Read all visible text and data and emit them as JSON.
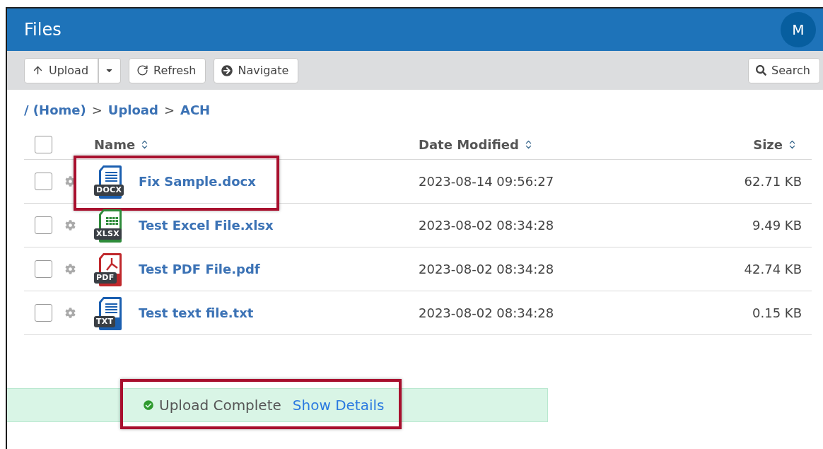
{
  "window": {
    "title": "Files",
    "avatar": "M"
  },
  "toolbar": {
    "buttons": [
      {
        "kind": "upload",
        "label": "Upload"
      },
      {
        "kind": "refresh",
        "label": "Refresh"
      },
      {
        "kind": "navigate",
        "label": "Navigate"
      }
    ],
    "search": "Search"
  },
  "breadcrumb": [
    "/ (Home)",
    "Upload",
    "ACH"
  ],
  "breadcrumb_separator": ">",
  "table": {
    "select_all_checked": false,
    "columns": [
      "Name",
      "Date Modified",
      "Size"
    ],
    "rows": [
      {
        "kind": "docx",
        "type_label": "DOCX",
        "name": "Fix Sample.docx",
        "date": "2023-08-14 09:56:27",
        "size": "62.71 KB",
        "checked": false,
        "highlighted": true
      },
      {
        "kind": "xlsx",
        "type_label": "XLSX",
        "name": "Test Excel File.xlsx",
        "date": "2023-08-02 08:34:28",
        "size": "9.49 KB",
        "checked": false,
        "highlighted": false
      },
      {
        "kind": "pdf",
        "type_label": "PDF",
        "name": "Test PDF File.pdf",
        "date": "2023-08-02 08:34:28",
        "size": "42.74 KB",
        "checked": false,
        "highlighted": false
      },
      {
        "kind": "txt",
        "type_label": "TXT",
        "name": "Test text file.txt",
        "date": "2023-08-02 08:34:28",
        "size": "0.15 KB",
        "checked": false,
        "highlighted": false
      }
    ]
  },
  "notification": {
    "message": "Upload Complete",
    "link": "Show Details",
    "highlighted": true
  }
}
